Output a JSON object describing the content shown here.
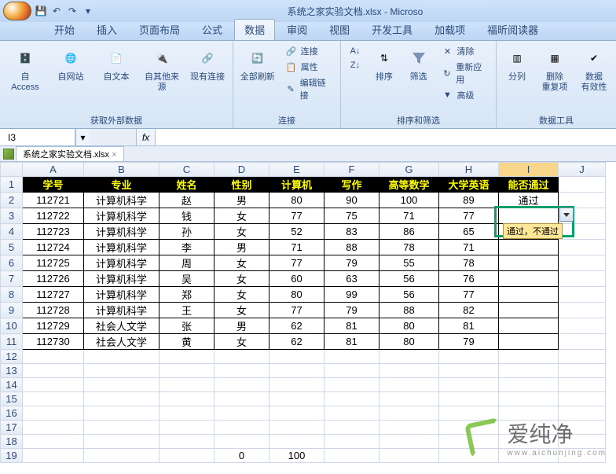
{
  "window": {
    "title": "系统之家实验文档.xlsx - Microso"
  },
  "tabs": [
    "开始",
    "插入",
    "页面布局",
    "公式",
    "数据",
    "审阅",
    "视图",
    "开发工具",
    "加载项",
    "福昕阅读器"
  ],
  "active_tab_index": 4,
  "ribbon": {
    "g1": {
      "label": "获取外部数据",
      "b": [
        "自 Access",
        "自网站",
        "自文本",
        "自其他来源",
        "现有连接"
      ]
    },
    "g2": {
      "label": "连接",
      "refresh": "全部刷新",
      "s": [
        "连接",
        "属性",
        "编辑链接"
      ]
    },
    "g3": {
      "label": "排序和筛选",
      "sort": "排序",
      "filter": "筛选",
      "s": [
        "清除",
        "重新应用",
        "高级"
      ]
    },
    "g4": {
      "label": "数据工具",
      "b": [
        "分列",
        "删除\n重复项",
        "数据\n有效性"
      ]
    }
  },
  "namebox": "I3",
  "worksheet_tab": "系统之家实验文档.xlsx",
  "columns": [
    "A",
    "B",
    "C",
    "D",
    "E",
    "F",
    "G",
    "H",
    "I",
    "J"
  ],
  "active_col": "I",
  "headers": [
    "学号",
    "专业",
    "姓名",
    "性别",
    "计算机",
    "写作",
    "高等数学",
    "大学英语",
    "能否通过"
  ],
  "rows": [
    {
      "n": 1
    },
    {
      "n": 2,
      "c": [
        "112721",
        "计算机科学",
        "赵",
        "男",
        "80",
        "90",
        "100",
        "89",
        "通过"
      ]
    },
    {
      "n": 3,
      "c": [
        "112722",
        "计算机科学",
        "钱",
        "女",
        "77",
        "75",
        "71",
        "77",
        ""
      ]
    },
    {
      "n": 4,
      "c": [
        "112723",
        "计算机科学",
        "孙",
        "女",
        "52",
        "83",
        "86",
        "65",
        ""
      ]
    },
    {
      "n": 5,
      "c": [
        "112724",
        "计算机科学",
        "李",
        "男",
        "71",
        "88",
        "78",
        "71",
        ""
      ]
    },
    {
      "n": 6,
      "c": [
        "112725",
        "计算机科学",
        "周",
        "女",
        "77",
        "79",
        "55",
        "78",
        ""
      ]
    },
    {
      "n": 7,
      "c": [
        "112726",
        "计算机科学",
        "吴",
        "女",
        "60",
        "63",
        "56",
        "76",
        ""
      ]
    },
    {
      "n": 8,
      "c": [
        "112727",
        "计算机科学",
        "郑",
        "女",
        "80",
        "99",
        "56",
        "77",
        ""
      ]
    },
    {
      "n": 9,
      "c": [
        "112728",
        "计算机科学",
        "王",
        "女",
        "77",
        "79",
        "88",
        "82",
        ""
      ]
    },
    {
      "n": 10,
      "c": [
        "112729",
        "社会人文学",
        "张",
        "男",
        "62",
        "81",
        "80",
        "81",
        ""
      ]
    },
    {
      "n": 11,
      "c": [
        "112730",
        "社会人文学",
        "黄",
        "女",
        "62",
        "81",
        "80",
        "79",
        ""
      ]
    },
    {
      "n": 12
    },
    {
      "n": 13
    },
    {
      "n": 14
    },
    {
      "n": 15
    },
    {
      "n": 16
    },
    {
      "n": 17
    },
    {
      "n": 18
    },
    {
      "n": 19,
      "c": [
        "",
        "",
        "",
        "0",
        "100",
        "",
        "",
        "",
        ""
      ]
    }
  ],
  "dv_tooltip": "通过，不通过",
  "watermark": {
    "brand": "爱纯净",
    "url": "www.aichunjing.com"
  }
}
